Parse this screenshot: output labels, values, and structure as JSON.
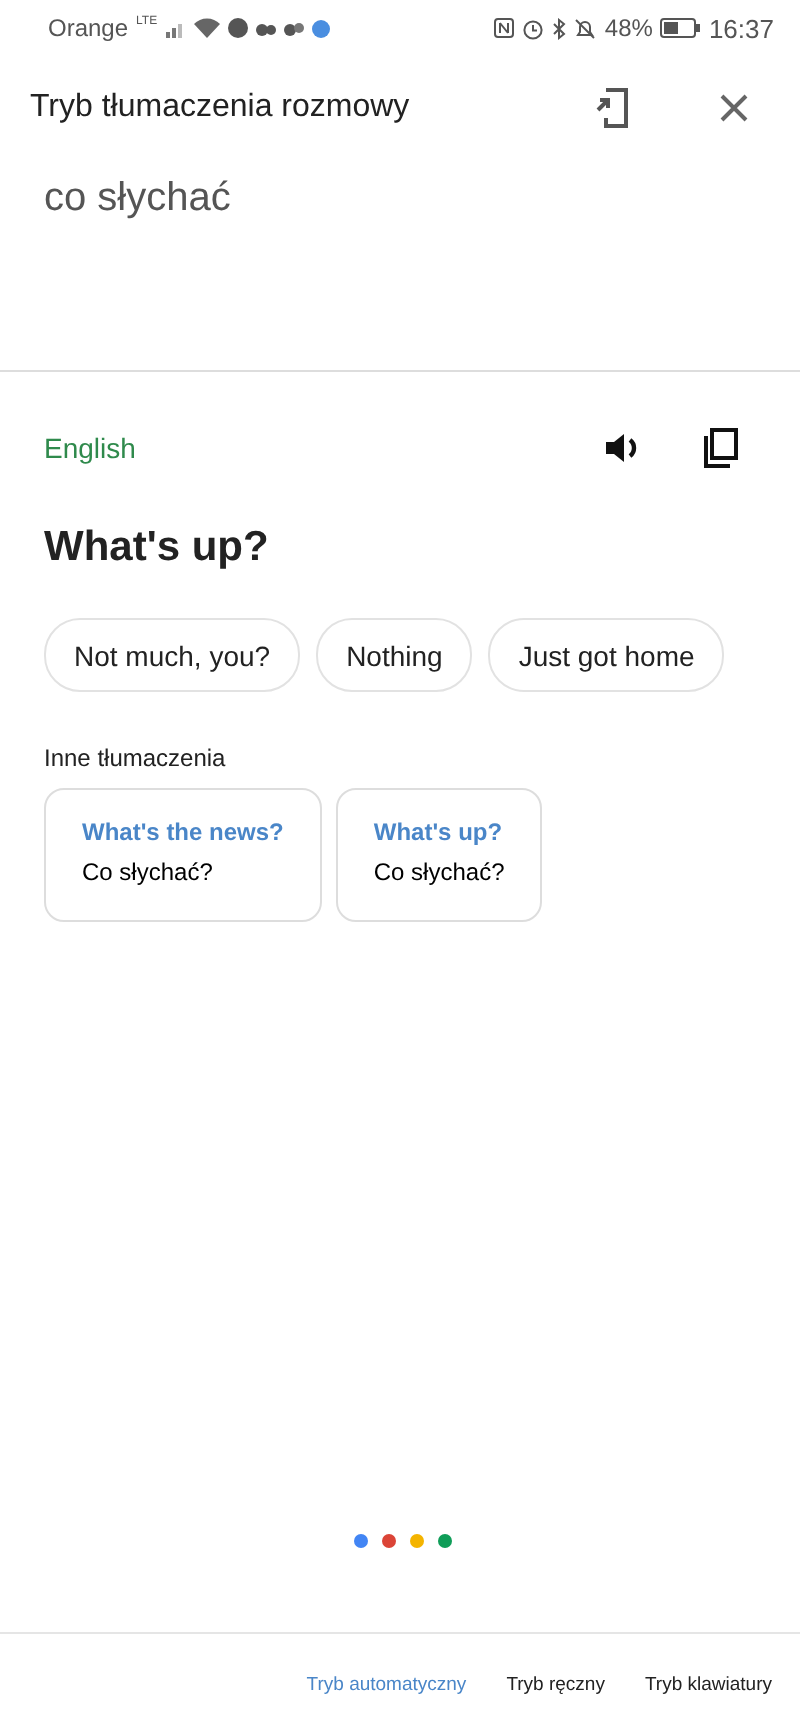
{
  "status_bar": {
    "carrier": "Orange",
    "network": "LTE",
    "battery": "48%",
    "time": "16:37"
  },
  "header": {
    "title": "Tryb tłumaczenia rozmowy"
  },
  "source": {
    "text": "co słychać"
  },
  "result": {
    "language": "English",
    "translation": "What's up?"
  },
  "suggestions": [
    "Not much, you?",
    "Nothing",
    "Just got home"
  ],
  "other_translations": {
    "label": "Inne tłumaczenia",
    "items": [
      {
        "translation": "What's the news?",
        "back_translation": "Co słychać?"
      },
      {
        "translation": "What's up?",
        "back_translation": "Co słychać?"
      }
    ]
  },
  "listening_dots": [
    {
      "color": "#4285f4"
    },
    {
      "color": "#db4437"
    },
    {
      "color": "#f4b400"
    },
    {
      "color": "#0f9d58"
    }
  ],
  "modes": [
    {
      "label": "Tryb automatyczny",
      "selected": true
    },
    {
      "label": "Tryb ręczny",
      "selected": false
    },
    {
      "label": "Tryb klawiatury",
      "selected": false
    }
  ]
}
